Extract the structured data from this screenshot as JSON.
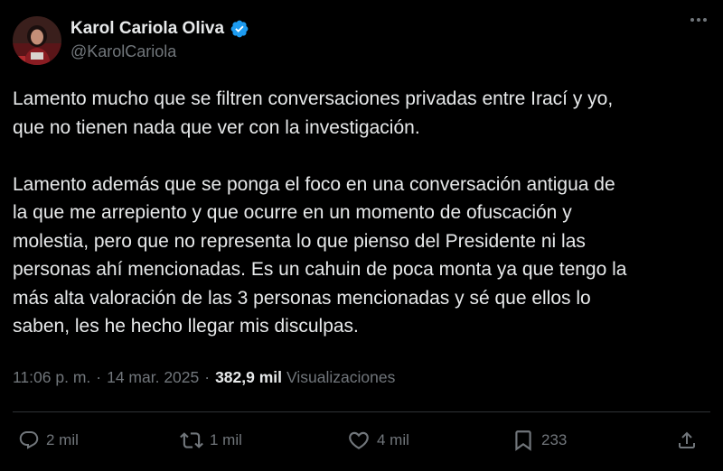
{
  "author": {
    "display_name": "Karol Cariola Oliva",
    "handle": "@KarolCariola",
    "verified": true,
    "verified_color": "#1d9bf0"
  },
  "icons": {
    "more": "more-options-icon",
    "reply": "reply-icon",
    "retweet": "retweet-icon",
    "like": "like-icon",
    "bookmark": "bookmark-icon",
    "share": "share-icon"
  },
  "body": {
    "paragraph1": [
      "Lamento mucho que se filtren conversaciones privadas entre Irací y yo,",
      "que no tienen nada que ver con la investigación."
    ],
    "paragraph2": [
      "Lamento además que se ponga el foco en una conversación antigua de",
      "la que me arrepiento y que ocurre en un momento de ofuscación y",
      "molestia, pero que no representa lo que pienso del Presidente ni las",
      "personas ahí mencionadas. Es un cahuin de poca monta ya que tengo la",
      "más alta valoración de las 3 personas mencionadas y sé que ellos lo",
      "saben, les he hecho llegar mis disculpas."
    ]
  },
  "meta": {
    "time": "11:06 p. m.",
    "separator": "·",
    "date": "14 mar. 2025",
    "views_count": "382,9 mil",
    "views_label": "Visualizaciones"
  },
  "actions": {
    "replies": "2 mil",
    "reposts": "1 mil",
    "likes": "4 mil",
    "bookmarks": "233"
  },
  "colors": {
    "background": "#000000",
    "text": "#e7e9ea",
    "secondary": "#71767b",
    "divider": "#2f3336"
  }
}
